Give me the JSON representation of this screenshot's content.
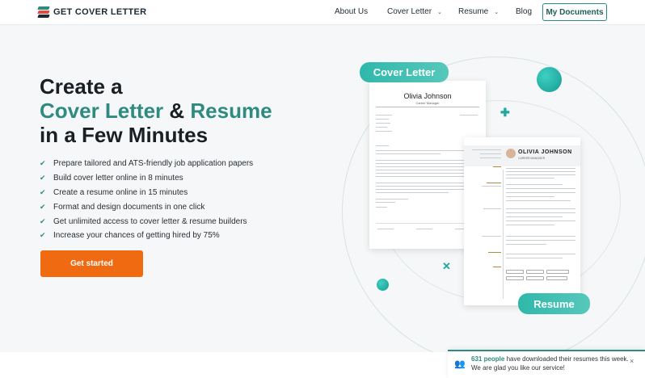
{
  "header": {
    "logo_text": "GET COVER LETTER",
    "nav": [
      {
        "label": "About Us",
        "has_dropdown": false
      },
      {
        "label": "Cover Letter",
        "has_dropdown": true
      },
      {
        "label": "Resume",
        "has_dropdown": true
      },
      {
        "label": "Blog",
        "has_dropdown": false
      }
    ],
    "my_documents": "My Documents"
  },
  "hero": {
    "title_line1": "Create a",
    "title_accent1": "Cover Letter",
    "title_amp": "&",
    "title_accent2": "Resume",
    "title_line3": "in a Few Minutes",
    "features": [
      "Prepare tailored and ATS-friendly job application papers",
      "Build cover letter online in 8 minutes",
      "Create a resume online in 15 minutes",
      "Format and design documents in one click",
      "Get unlimited access to cover letter & resume builders",
      "Increase your chances of getting hired by 75%"
    ],
    "cta": "Get started"
  },
  "illustration": {
    "cover_letter_tag": "Cover Letter",
    "resume_tag": "Resume",
    "cl_name": "Olivia Johnson",
    "cl_role": "Career Manager",
    "rs_name": "OLIVIA JOHNSON",
    "rs_role": "CAREER MANAGER"
  },
  "toast": {
    "count_text": "631 people",
    "line1_rest": " have downloaded their resumes this week.",
    "line2": "We are glad you like our service!",
    "close": "×"
  },
  "colors": {
    "accent": "#2f8a80",
    "cta": "#f06a12",
    "teal_tag": "#2fb8ab"
  }
}
